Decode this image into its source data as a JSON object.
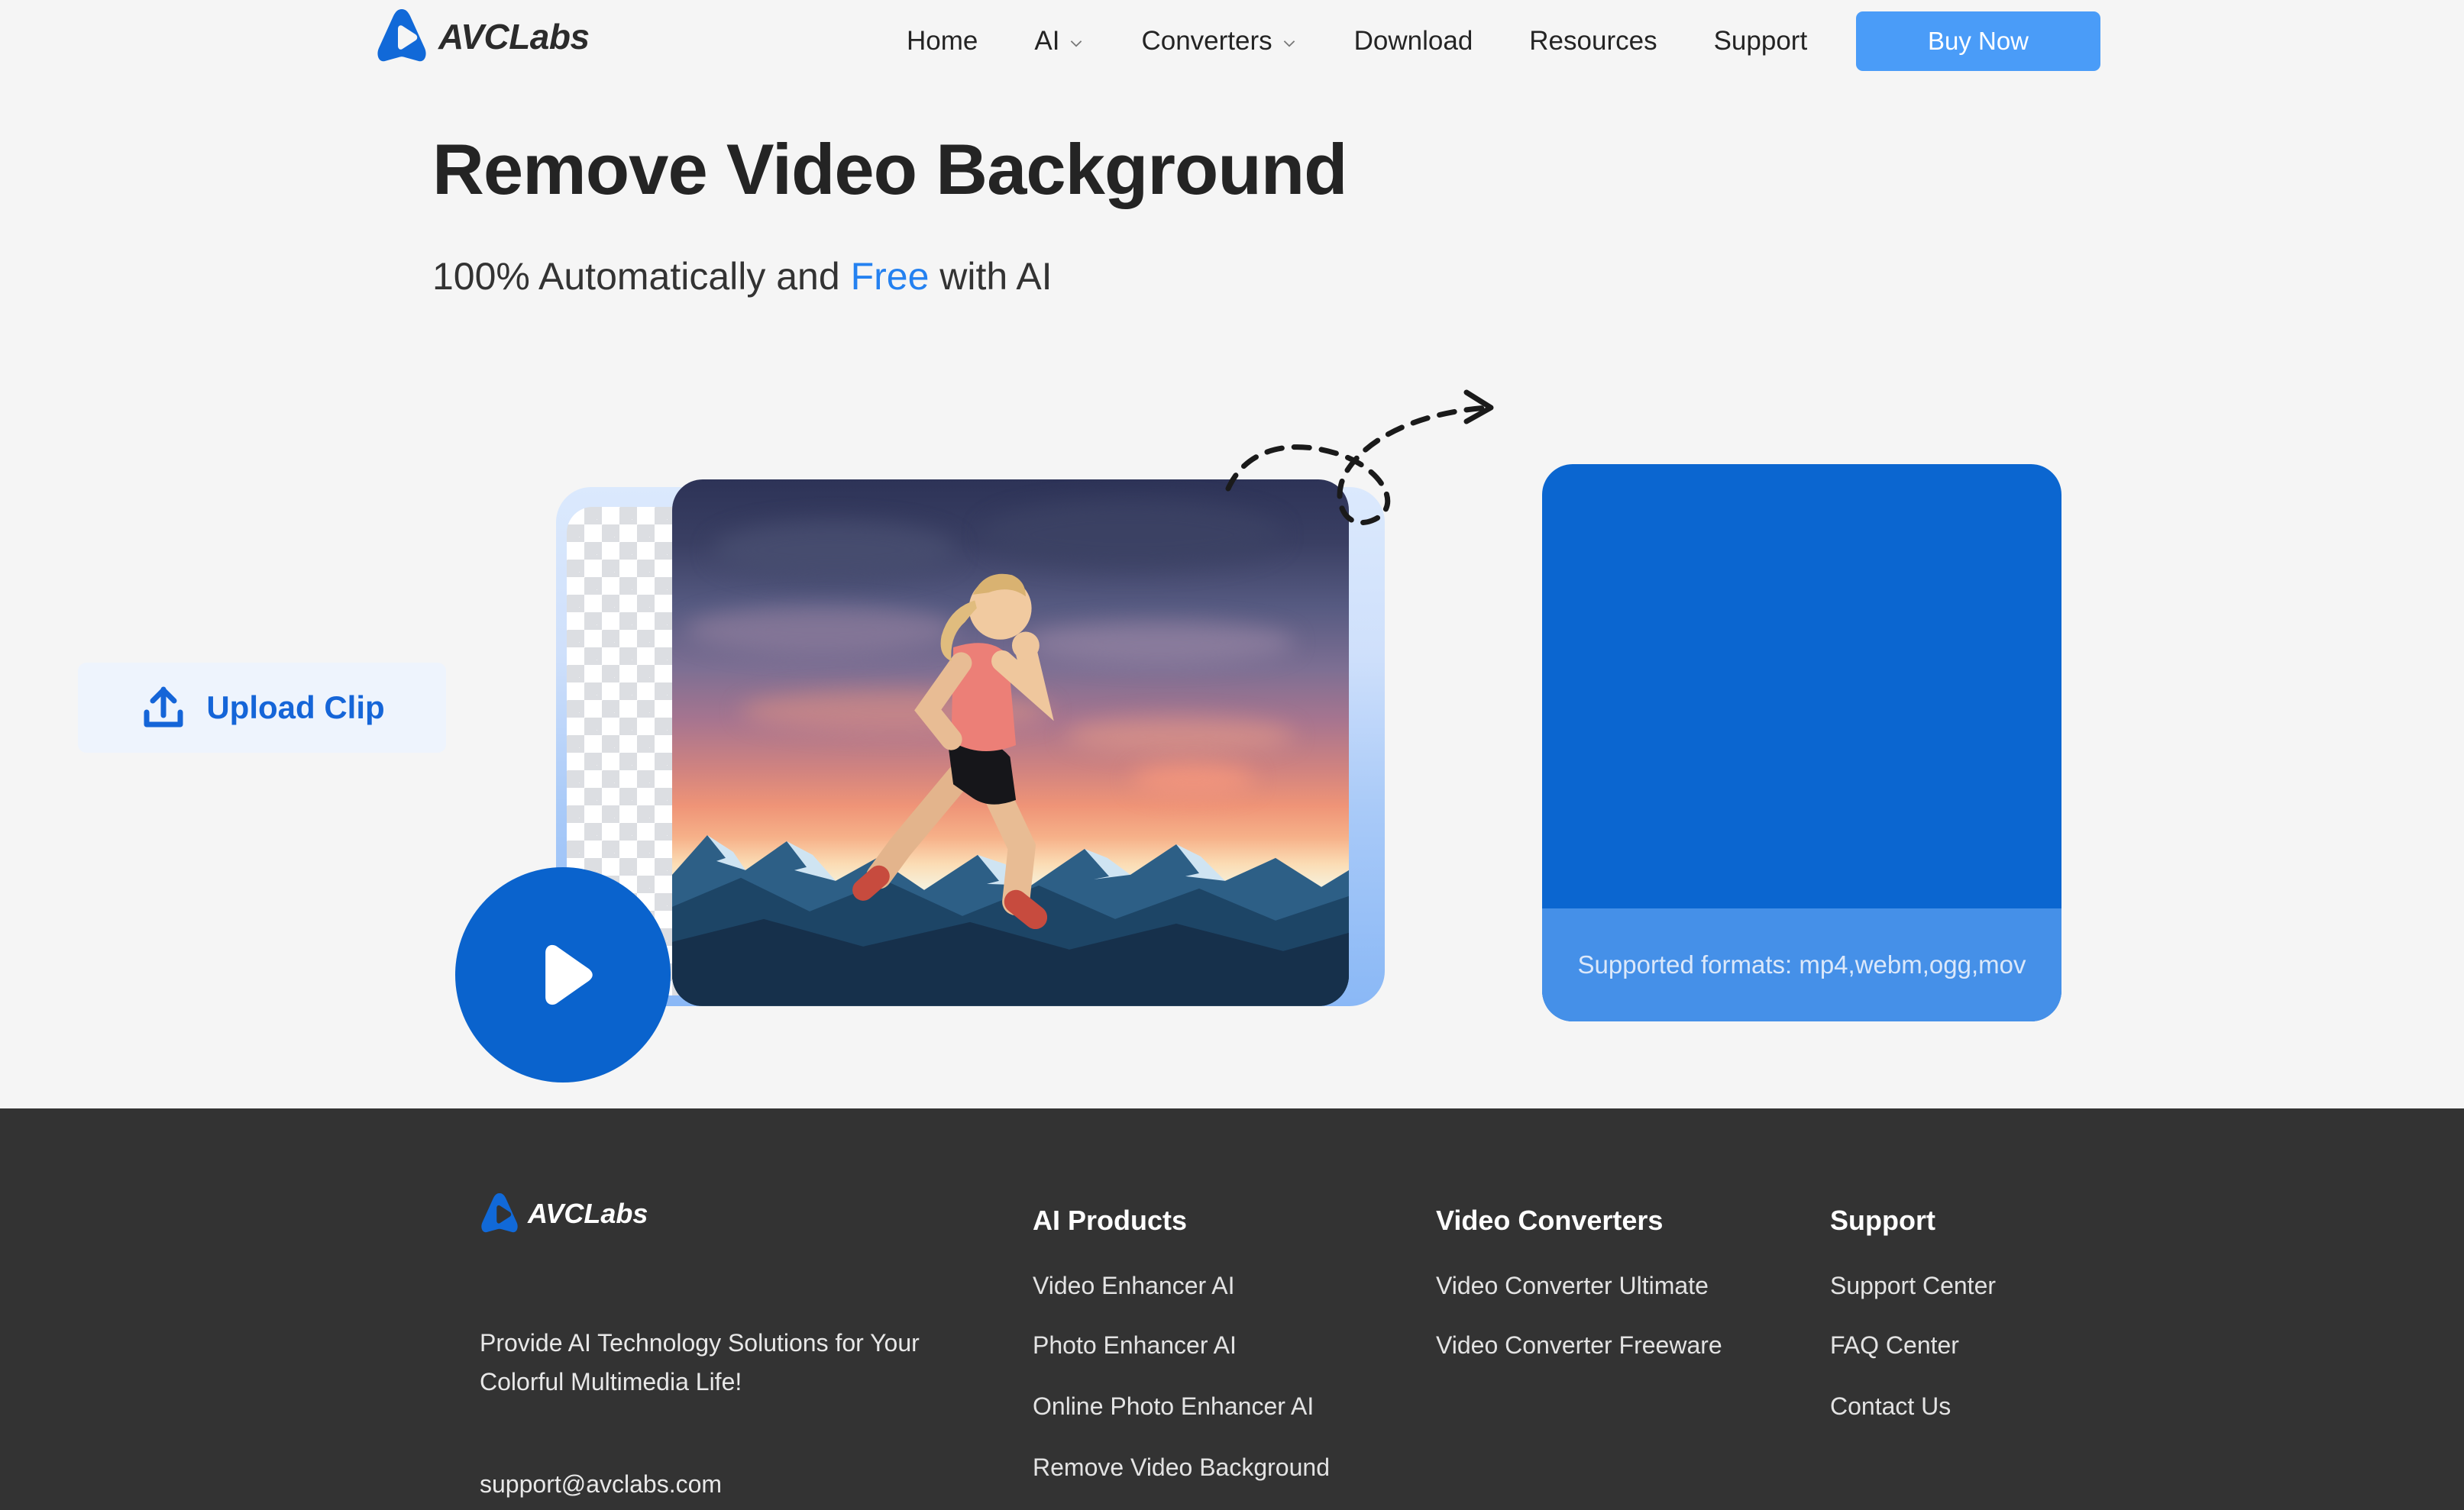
{
  "header": {
    "brand": {
      "name": "AVCLabs",
      "logo_icon": "avclabs-play-logo",
      "color": "#1169d8"
    },
    "nav": [
      {
        "label": "Home",
        "has_dropdown": false
      },
      {
        "label": "AI",
        "has_dropdown": true
      },
      {
        "label": "Converters",
        "has_dropdown": true
      },
      {
        "label": "Download",
        "has_dropdown": false
      },
      {
        "label": "Resources",
        "has_dropdown": false
      },
      {
        "label": "Support",
        "has_dropdown": false
      }
    ],
    "buy_button": {
      "label": "Buy Now",
      "color": "#4a9cf8"
    }
  },
  "hero": {
    "title": "Remove Video Background",
    "sub_before": "100% Automatically and ",
    "sub_accent": "Free",
    "sub_after": " with AI",
    "accent_color": "#2481f0"
  },
  "preview": {
    "play_button_icon": "play-icon",
    "transparency_checkerboard": "checkerboard-pattern",
    "image_alt": "woman running at sunset over snowy mountains",
    "arrow_icon": "curved-dashed-arrow-icon"
  },
  "upload": {
    "button_label": "Upload Clip",
    "button_icon": "upload-icon",
    "formats_text": "Supported formats: mp4,webm,ogg,mov",
    "panel_color": "#0b66d0",
    "formats_bar_color": "#4590e8"
  },
  "footer": {
    "brand": {
      "name": "AVCLabs",
      "logo_icon": "avclabs-play-logo"
    },
    "tagline": "Provide AI Technology Solutions for Your Colorful Multimedia Life!",
    "email": "support@avclabs.com",
    "columns": [
      {
        "heading": "AI Products",
        "links": [
          "Video Enhancer AI",
          "Photo Enhancer AI",
          "Online Photo Enhancer AI",
          "Remove Video Background"
        ]
      },
      {
        "heading": "Video Converters",
        "links": [
          "Video Converter Ultimate",
          "Video Converter Freeware"
        ]
      },
      {
        "heading": "Support",
        "links": [
          "Support Center",
          "FAQ Center",
          "Contact Us"
        ]
      }
    ]
  }
}
